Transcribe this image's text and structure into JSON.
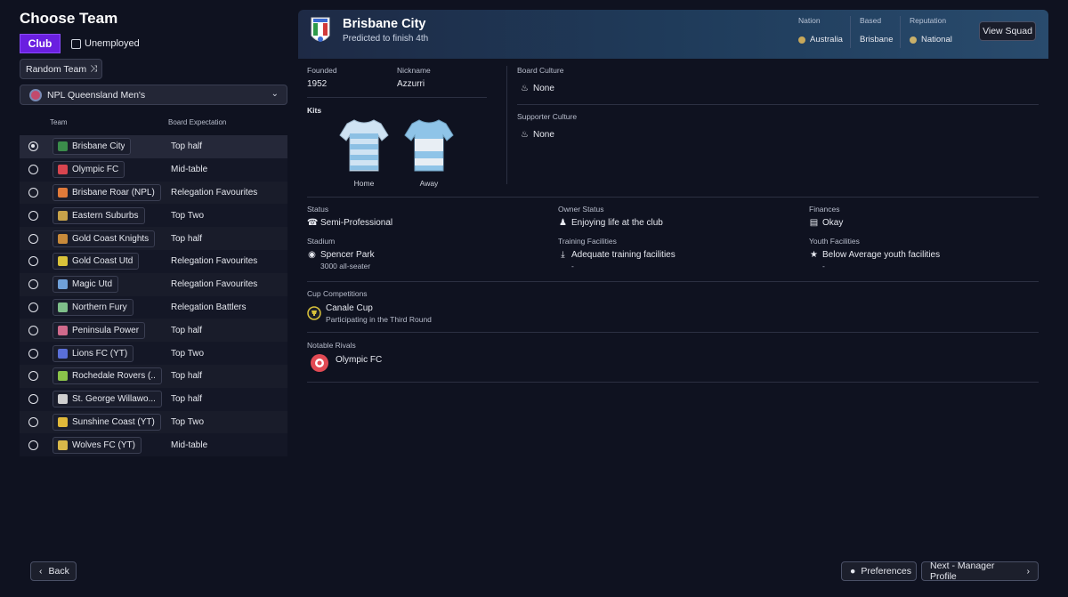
{
  "page_title": "Choose Team",
  "type_toggle": {
    "club_label": "Club",
    "unemployed_label": "Unemployed"
  },
  "random_team_label": "Random Team",
  "league": {
    "selected": "NPL Queensland Men's"
  },
  "table": {
    "headers": {
      "team": "Team",
      "board_expectation": "Board Expectation"
    },
    "rows": [
      {
        "team": "Brisbane City",
        "expectation": "Top half",
        "selected": true,
        "crest_color": "#3b8c4b"
      },
      {
        "team": "Olympic FC",
        "expectation": "Mid-table",
        "selected": false,
        "crest_color": "#d8454f"
      },
      {
        "team": "Brisbane Roar (NPL)",
        "expectation": "Relegation Favourites",
        "selected": false,
        "crest_color": "#e07a3a"
      },
      {
        "team": "Eastern Suburbs",
        "expectation": "Top Two",
        "selected": false,
        "crest_color": "#c7a24a"
      },
      {
        "team": "Gold Coast Knights",
        "expectation": "Top half",
        "selected": false,
        "crest_color": "#c88a3a"
      },
      {
        "team": "Gold Coast Utd",
        "expectation": "Relegation Favourites",
        "selected": false,
        "crest_color": "#d9c23a"
      },
      {
        "team": "Magic Utd",
        "expectation": "Relegation Favourites",
        "selected": false,
        "crest_color": "#6fa0d8"
      },
      {
        "team": "Northern Fury",
        "expectation": "Relegation Battlers",
        "selected": false,
        "crest_color": "#7fbf8a"
      },
      {
        "team": "Peninsula Power",
        "expectation": "Top half",
        "selected": false,
        "crest_color": "#d06a8c"
      },
      {
        "team": "Lions FC (YT)",
        "expectation": "Top Two",
        "selected": false,
        "crest_color": "#5a6fd8"
      },
      {
        "team": "Rochedale Rovers (...",
        "expectation": "Top half",
        "selected": false,
        "crest_color": "#8bc34a"
      },
      {
        "team": "St. George Willawo...",
        "expectation": "Top half",
        "selected": false,
        "crest_color": "#cfcfcf"
      },
      {
        "team": "Sunshine Coast  (YT)",
        "expectation": "Top Two",
        "selected": false,
        "crest_color": "#e0b83a"
      },
      {
        "team": "Wolves FC (YT)",
        "expectation": "Mid-table",
        "selected": false,
        "crest_color": "#d8b84a"
      }
    ]
  },
  "club": {
    "name": "Brisbane City",
    "predicted": "Predicted to finish 4th",
    "nation_label": "Nation",
    "nation": "Australia",
    "based_label": "Based",
    "based": "Brisbane",
    "reputation_label": "Reputation",
    "reputation": "National",
    "view_squad": "View Squad",
    "founded_label": "Founded",
    "founded": "1952",
    "nickname_label": "Nickname",
    "nickname": "Azzurri",
    "kits_label": "Kits",
    "kit_home": "Home",
    "kit_away": "Away",
    "board_culture_label": "Board Culture",
    "board_culture": "None",
    "supporter_culture_label": "Supporter Culture",
    "supporter_culture": "None",
    "status_label": "Status",
    "status": "Semi-Professional",
    "owner_status_label": "Owner Status",
    "owner_status": "Enjoying life at the club",
    "finances_label": "Finances",
    "finances": "Okay",
    "stadium_label": "Stadium",
    "stadium": "Spencer Park",
    "stadium_capacity": "3000 all-seater",
    "training_label": "Training Facilities",
    "training": "Adequate training facilities",
    "training_sub": "-",
    "youth_label": "Youth Facilities",
    "youth": "Below Average youth facilities",
    "youth_sub": "-",
    "cup_label": "Cup Competitions",
    "cup_name": "Canale Cup",
    "cup_sub": "Participating in the Third Round",
    "rivals_label": "Notable Rivals",
    "rival": "Olympic FC"
  },
  "footer": {
    "back": "Back",
    "preferences": "Preferences",
    "next": "Next - Manager Profile"
  }
}
